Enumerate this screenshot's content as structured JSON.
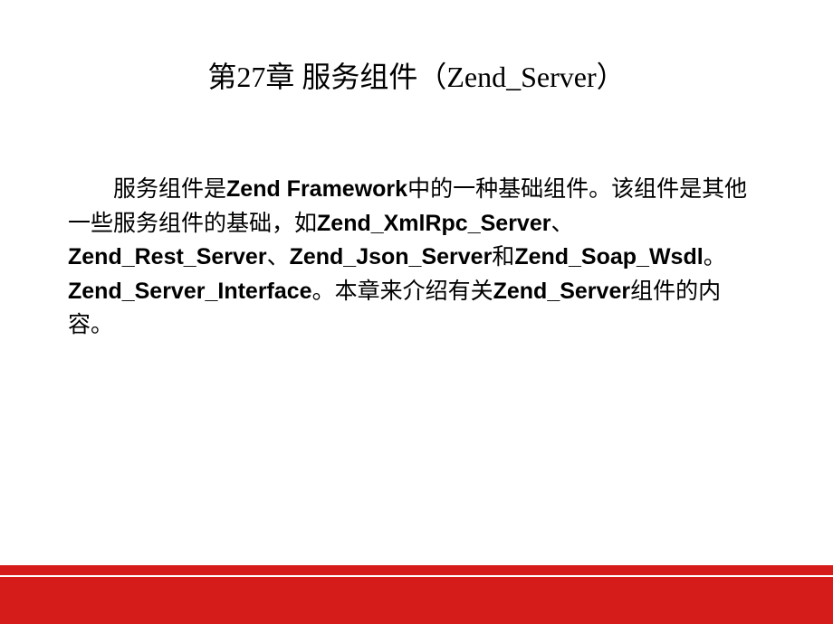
{
  "title": "第27章  服务组件（Zend_Server）",
  "body": {
    "part1": "服务组件是",
    "part2": "Zend Framework",
    "part3": "中的一种基础组件。该组件是其他一些服务组件的基础，如",
    "part4": "Zend_XmlRpc_Server",
    "part5": "、",
    "part6": "Zend_Rest_Server",
    "part7": "、",
    "part8": "Zend_Json_Server",
    "part9": "和",
    "part10": "Zend_Soap_Wsdl",
    "part11": "。",
    "part12": "Zend_Server_Interface",
    "part13": "。本章来介绍有关",
    "part14": "Zend_Server",
    "part15": "组件的内容。"
  }
}
